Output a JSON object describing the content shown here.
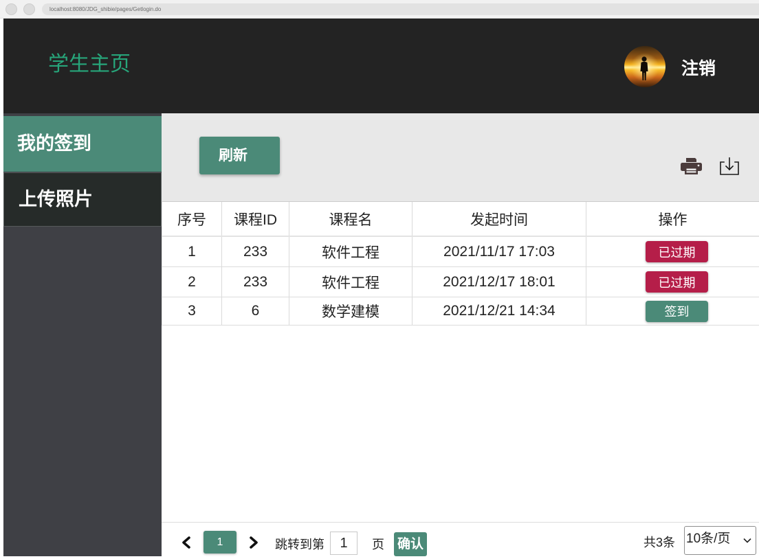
{
  "browser": {
    "url": "localhost:8080/JDG_shibie/pages/Getlogin.do"
  },
  "header": {
    "title": "学生主页",
    "avatar_icon": "user-avatar-icon",
    "logout_label": "注销"
  },
  "sidebar": {
    "items": [
      {
        "label": "我的签到",
        "active": true
      },
      {
        "label": "上传照片",
        "active": false
      }
    ]
  },
  "toolbar": {
    "refresh_label": "刷新",
    "print_icon": "printer-icon",
    "export_icon": "download-icon"
  },
  "table": {
    "columns": [
      "序号",
      "课程ID",
      "课程名",
      "发起时间",
      "操作"
    ],
    "rows": [
      {
        "index": "1",
        "course_id": "233",
        "course_name": "软件工程",
        "start_time": "2021/11/17 17:03",
        "action": "已过期"
      },
      {
        "index": "2",
        "course_id": "233",
        "course_name": "软件工程",
        "start_time": "2021/12/17 18:01",
        "action": "已过期"
      },
      {
        "index": "3",
        "course_id": "6",
        "course_name": "数学建模",
        "start_time": "2021/12/21 14:34",
        "action": "签到"
      }
    ]
  },
  "pagination": {
    "prev_icon": "chevron-left-icon",
    "current_page": "1",
    "next_icon": "chevron-right-icon",
    "jump_prefix": "跳转到第",
    "jump_value": "1",
    "jump_suffix": "页",
    "confirm_label": "确认",
    "total_label": "共3条",
    "page_size": "10条/页",
    "page_size_icon": "chevron-down-icon"
  },
  "colors": {
    "header_bg": "#232323",
    "title_green": "#27a57a",
    "primary": "#4b8a78",
    "danger": "#b51e49",
    "sidebar_bg": "#3f4045",
    "toolbar_bg": "#e8e8e8"
  }
}
